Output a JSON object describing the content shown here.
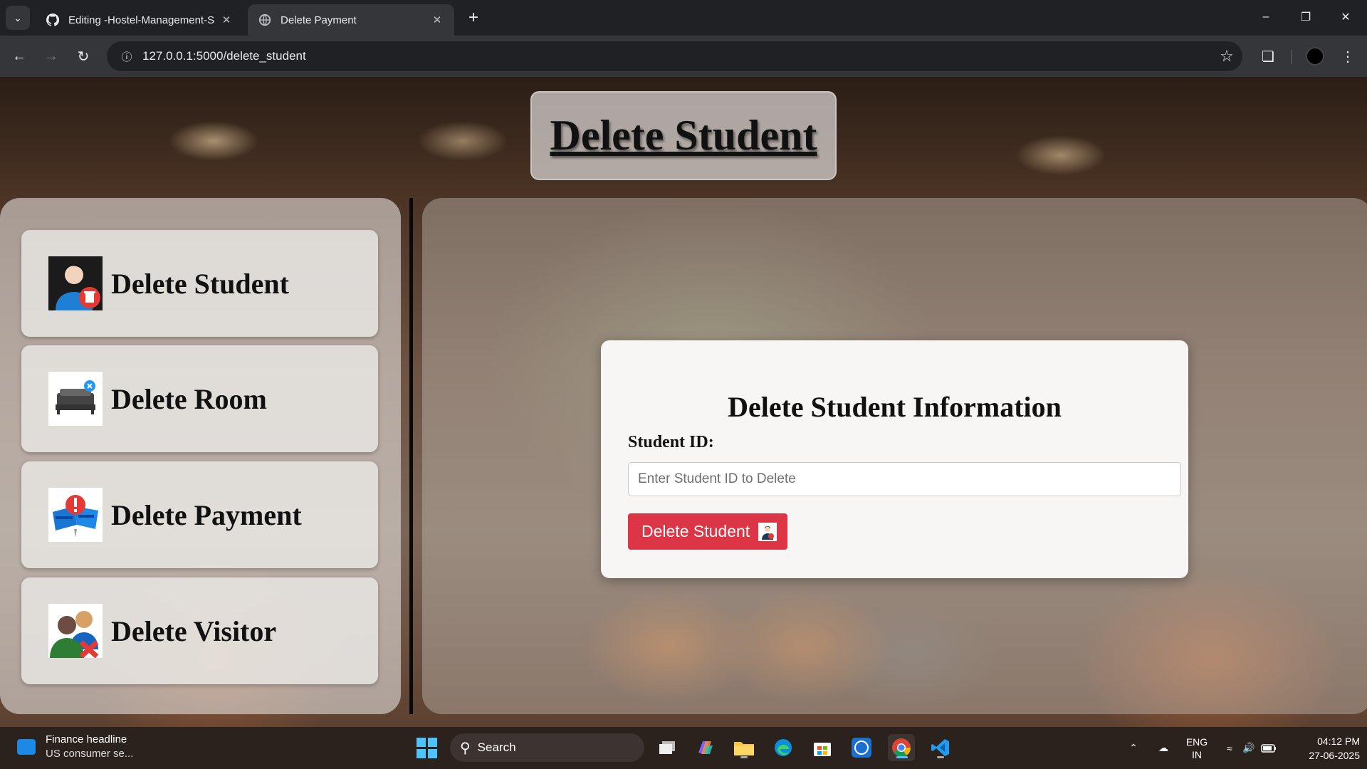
{
  "browser": {
    "tabs": [
      {
        "title": "Editing -Hostel-Management-S",
        "icon": "github-icon",
        "active": false
      },
      {
        "title": "Delete Payment",
        "icon": "globe-icon",
        "active": true
      }
    ],
    "url": "127.0.0.1:5000/delete_student"
  },
  "page": {
    "title": "Delete Student",
    "sidebar": {
      "items": [
        {
          "label": "Delete Student",
          "icon": "delete-student-icon"
        },
        {
          "label": "Delete Room",
          "icon": "delete-room-icon"
        },
        {
          "label": "Delete Payment",
          "icon": "delete-payment-icon"
        },
        {
          "label": "Delete Visitor",
          "icon": "delete-visitor-icon"
        }
      ]
    },
    "form": {
      "heading": "Delete Student Information",
      "label": "Student ID:",
      "placeholder": "Enter Student ID to Delete",
      "button": "Delete Student"
    }
  },
  "taskbar": {
    "news_headline": "Finance headline",
    "news_sub": "US consumer se...",
    "search": "Search",
    "lang": "ENG",
    "region": "IN",
    "time": "04:12 PM",
    "date": "27-06-2025"
  },
  "colors": {
    "accent_button": "#dc3545",
    "chrome_dark": "#202124",
    "chrome_mid": "#35363a"
  }
}
